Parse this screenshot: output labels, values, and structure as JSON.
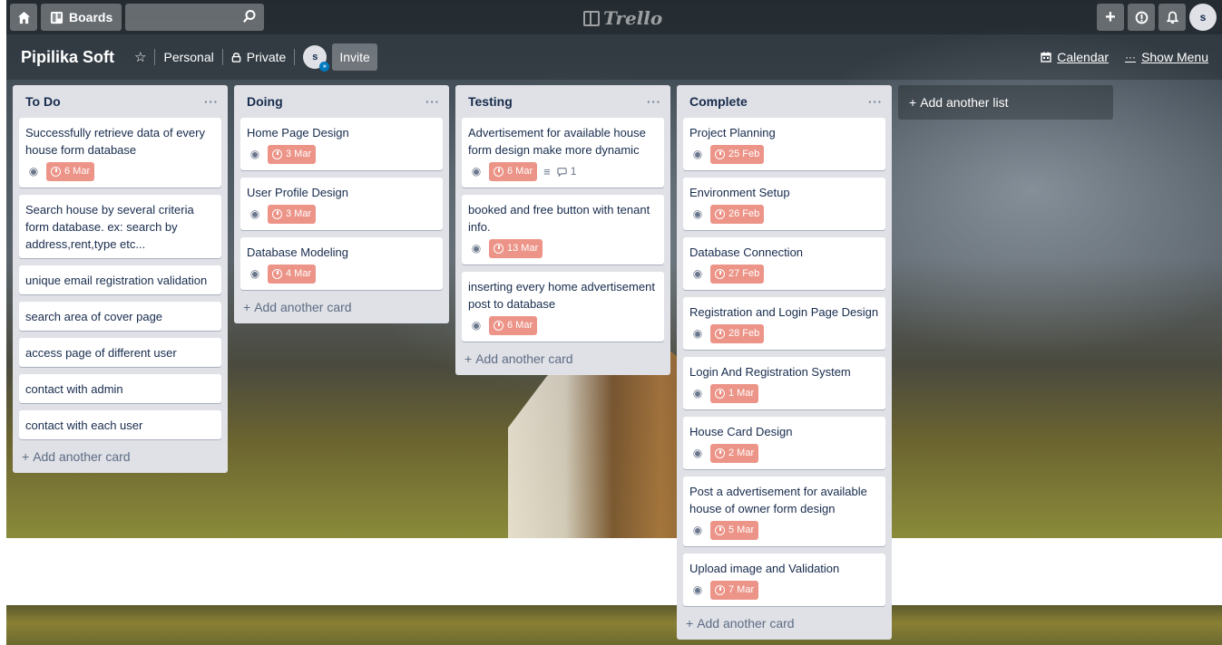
{
  "topbar": {
    "boards_label": "Boards",
    "search_placeholder": "",
    "logo": "Trello",
    "avatar_initial": "s"
  },
  "board": {
    "title": "Pipilika Soft",
    "team": "Personal",
    "visibility": "Private",
    "member_initial": "s",
    "invite_label": "Invite",
    "calendar_label": "Calendar",
    "show_menu_label": "Show Menu"
  },
  "lists": [
    {
      "title": "To Do",
      "cards": [
        {
          "title": "Successfully retrieve data of every house form database",
          "due": "6 Mar"
        },
        {
          "title": "Search house by several criteria form database. ex: search by address,rent,type etc..."
        },
        {
          "title": "unique email registration validation"
        },
        {
          "title": "search area of cover page"
        },
        {
          "title": "access page of different user"
        },
        {
          "title": "contact with admin"
        },
        {
          "title": "contact with each user"
        }
      ],
      "add_card_label": "Add another card"
    },
    {
      "title": "Doing",
      "cards": [
        {
          "title": "Home Page Design",
          "due": "3 Mar"
        },
        {
          "title": "User Profile Design",
          "due": "3 Mar"
        },
        {
          "title": "Database Modeling",
          "due": "4 Mar"
        }
      ],
      "add_card_label": "Add another card"
    },
    {
      "title": "Testing",
      "cards": [
        {
          "title": "Advertisement for available house form design make more dynamic",
          "due": "6 Mar",
          "comments": "1"
        },
        {
          "title": "booked and free button with tenant info.",
          "due": "13 Mar"
        },
        {
          "title": "inserting every home advertisement post to database",
          "due": "6 Mar"
        }
      ],
      "add_card_label": "Add another card"
    },
    {
      "title": "Complete",
      "cards": [
        {
          "title": "Project Planning",
          "due": "25 Feb"
        },
        {
          "title": "Environment Setup",
          "due": "26 Feb"
        },
        {
          "title": "Database Connection",
          "due": "27 Feb"
        },
        {
          "title": "Registration and Login Page Design",
          "due": "28 Feb"
        },
        {
          "title": "Login And Registration System",
          "due": "1 Mar"
        },
        {
          "title": "House Card Design",
          "due": "2 Mar"
        },
        {
          "title": "Post a advertisement for available house of owner form design",
          "due": "5 Mar"
        },
        {
          "title": "Upload image and Validation",
          "due": "7 Mar"
        }
      ],
      "add_card_label": "Add another card"
    }
  ],
  "add_list_label": "Add another list",
  "colors": {
    "due_badge": "#ec9488",
    "list_bg": "#dfe1e6",
    "card_bg": "#ffffff"
  },
  "icons": {
    "home": "home-icon",
    "boards": "boards-icon",
    "search": "search-icon",
    "plus": "plus-icon",
    "info": "info-icon",
    "bell": "bell-icon",
    "star": "star-icon",
    "lock": "lock-icon",
    "calendar": "calendar-icon",
    "watch": "eye-icon",
    "due": "clock-icon",
    "description": "description-icon",
    "comment": "comment-icon"
  }
}
